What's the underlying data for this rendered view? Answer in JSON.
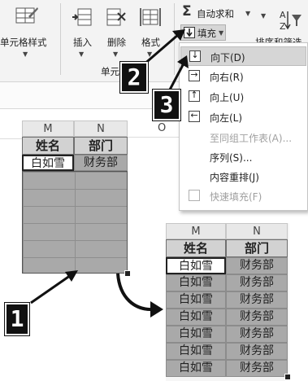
{
  "ribbon": {
    "cell_styles_label": "单元格样式",
    "insert_label": "插入",
    "delete_label": "删除",
    "format_label": "格式",
    "cells_group_label": "单元",
    "autosum_label": "自动求和",
    "fill_label": "填充",
    "sort_filter_label": "排序和筛选"
  },
  "fill_menu": {
    "items": [
      {
        "label": "向下(D)",
        "icon": "arrow-down-icon",
        "glyph": "↓",
        "enabled": true,
        "highlighted": true
      },
      {
        "label": "向右(R)",
        "icon": "arrow-right-icon",
        "glyph": "→",
        "enabled": true,
        "highlighted": false
      },
      {
        "label": "向上(U)",
        "icon": "arrow-up-icon",
        "glyph": "↑",
        "enabled": true,
        "highlighted": false
      },
      {
        "label": "向左(L)",
        "icon": "arrow-left-icon",
        "glyph": "←",
        "enabled": true,
        "highlighted": false
      },
      {
        "label": "至同组工作表(A)...",
        "icon": "",
        "glyph": "",
        "enabled": false,
        "highlighted": false
      },
      {
        "label": "序列(S)...",
        "icon": "",
        "glyph": "",
        "enabled": true,
        "highlighted": false
      },
      {
        "label": "内容重排(J)",
        "icon": "",
        "glyph": "",
        "enabled": true,
        "highlighted": false
      },
      {
        "label": "快速填充(F)",
        "icon": "flash-fill-icon",
        "glyph": "",
        "enabled": false,
        "highlighted": false
      }
    ]
  },
  "sheet_before": {
    "col_headers": [
      "M",
      "N",
      "O"
    ],
    "headers": [
      "姓名",
      "部门"
    ],
    "first_row": [
      "白如雪",
      "财务部"
    ]
  },
  "sheet_after": {
    "col_headers": [
      "M",
      "N"
    ],
    "headers": [
      "姓名",
      "部门"
    ],
    "rows": [
      [
        "白如雪",
        "财务部"
      ],
      [
        "白如雪",
        "财务部"
      ],
      [
        "白如雪",
        "财务部"
      ],
      [
        "白如雪",
        "财务部"
      ],
      [
        "白如雪",
        "财务部"
      ],
      [
        "白如雪",
        "财务部"
      ],
      [
        "白如雪",
        "财务部"
      ]
    ]
  },
  "steps": {
    "step1": "1",
    "step2": "2",
    "step3": "3"
  },
  "colors": {
    "highlight": "#d6d6d6",
    "selection": "#a9a9a9",
    "badge": "#111111"
  }
}
